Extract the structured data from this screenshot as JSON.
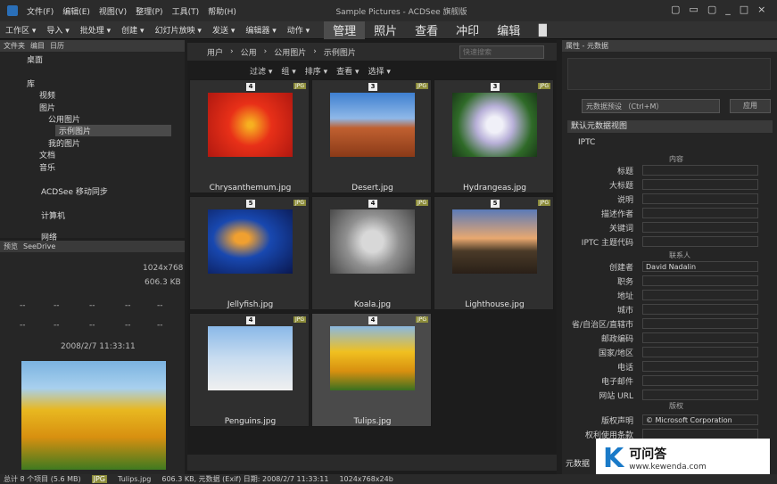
{
  "window": {
    "title": "Sample Pictures - ACDSee 旗舰版",
    "controls": [
      "▢",
      "▭",
      "▢",
      "_",
      "□",
      "×"
    ]
  },
  "menu": [
    "文件(F)",
    "编辑(E)",
    "视图(V)",
    "整理(P)",
    "工具(T)",
    "帮助(H)"
  ],
  "toolbar": {
    "items": [
      "工作区 ▾",
      "导入 ▾",
      "批处理 ▾",
      "创建 ▾",
      "幻灯片放映 ▾",
      "发送 ▾",
      "编辑器 ▾",
      "动作 ▾"
    ],
    "modes": [
      "管理",
      "照片",
      "查看",
      "冲印",
      "编辑"
    ]
  },
  "left_tabs": [
    "文件夹",
    "编目",
    "日历"
  ],
  "tree": [
    {
      "label": "桌面"
    },
    {
      "label": "库"
    },
    {
      "label": "视频"
    },
    {
      "label": "图片"
    },
    {
      "label": "公用图片"
    },
    {
      "label": "示例图片"
    },
    {
      "label": "我的图片"
    },
    {
      "label": "文档"
    },
    {
      "label": "音乐"
    },
    {
      "label": "ACDSee 移动同步"
    },
    {
      "label": "计算机"
    },
    {
      "label": "网络"
    }
  ],
  "preview": {
    "tabs": [
      "预览",
      "SeeDrive"
    ],
    "dims": "1024x768",
    "size": "606.3 KB",
    "cells": [
      "--",
      "--",
      "--",
      "--",
      "--",
      "--",
      "--",
      "--",
      "--",
      "--",
      "--",
      "--"
    ],
    "date": "2008/2/7 11:33:11"
  },
  "breadcrumb": [
    "用户",
    "公用",
    "公用图片",
    "示例图片"
  ],
  "search_placeholder": "快速搜索",
  "filter_bar": [
    "过滤 ▾",
    "组 ▾",
    "排序 ▾",
    "查看 ▾",
    "选择 ▾"
  ],
  "thumbs": [
    {
      "name": "Chrysanthemum.jpg",
      "rating": "4",
      "fmt": "JPG"
    },
    {
      "name": "Desert.jpg",
      "rating": "3",
      "fmt": "JPG"
    },
    {
      "name": "Hydrangeas.jpg",
      "rating": "3",
      "fmt": "JPG"
    },
    {
      "name": "Jellyfish.jpg",
      "rating": "5",
      "fmt": "JPG"
    },
    {
      "name": "Koala.jpg",
      "rating": "4",
      "fmt": "JPG"
    },
    {
      "name": "Lighthouse.jpg",
      "rating": "5",
      "fmt": "JPG"
    },
    {
      "name": "Penguins.jpg",
      "rating": "4",
      "fmt": "JPG"
    },
    {
      "name": "Tulips.jpg",
      "rating": "4",
      "fmt": "JPG"
    }
  ],
  "props": {
    "title": "属性 - 元数据",
    "preset": "元数据预设 （Ctrl+M）",
    "apply": "应用",
    "view": "默认元数据视图",
    "section": "IPTC",
    "sub_content": "内容",
    "sub_contact": "联系人",
    "sub_rights": "版权",
    "rows": [
      {
        "label": "标题",
        "value": ""
      },
      {
        "label": "大标题",
        "value": ""
      },
      {
        "label": "说明",
        "value": ""
      },
      {
        "label": "描述作者",
        "value": ""
      },
      {
        "label": "关键词",
        "value": ""
      },
      {
        "label": "IPTC 主题代码",
        "value": ""
      },
      {
        "label": "创建者",
        "value": "David Nadalin"
      },
      {
        "label": "职务",
        "value": ""
      },
      {
        "label": "地址",
        "value": ""
      },
      {
        "label": "城市",
        "value": ""
      },
      {
        "label": "省/自治区/直辖市",
        "value": ""
      },
      {
        "label": "邮政编码",
        "value": ""
      },
      {
        "label": "国家/地区",
        "value": ""
      },
      {
        "label": "电话",
        "value": ""
      },
      {
        "label": "电子邮件",
        "value": ""
      },
      {
        "label": "网站 URL",
        "value": ""
      },
      {
        "label": "版权声明",
        "value": "© Microsoft Corporation"
      },
      {
        "label": "权利使用条款",
        "value": ""
      }
    ],
    "bottom_tab": "元数据"
  },
  "statusbar": [
    "总计 8 个项目 (5.6 MB)",
    "JPG",
    "Tulips.jpg",
    "606.3 KB, 元数据 (Exif) 日期: 2008/2/7 11:33:11",
    "1024x768x24b"
  ],
  "watermark": {
    "logo": "K",
    "text": "可问答",
    "url": "www.kewenda.com"
  }
}
